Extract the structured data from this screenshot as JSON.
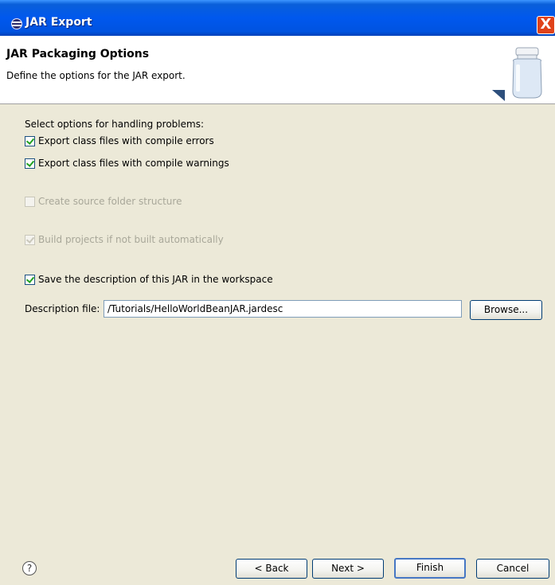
{
  "window": {
    "title": "JAR Export",
    "close_label": "X"
  },
  "header": {
    "title": "JAR Packaging Options",
    "description": "Define the options for the JAR export."
  },
  "problems": {
    "heading": "Select options for handling problems:",
    "export_errors": {
      "label": "Export class files with compile errors",
      "checked": true,
      "enabled": true
    },
    "export_warnings": {
      "label": "Export class files with compile warnings",
      "checked": true,
      "enabled": true
    }
  },
  "source_folder": {
    "label": "Create source folder structure",
    "checked": false,
    "enabled": false
  },
  "build_projects": {
    "label": "Build projects if not built automatically",
    "checked": true,
    "enabled": false
  },
  "save_description": {
    "label": "Save the description of this JAR in the workspace",
    "checked": true,
    "enabled": true
  },
  "description_file": {
    "label": "Description file:",
    "value": "/Tutorials/HelloWorldBeanJAR.jardesc",
    "browse_label": "Browse..."
  },
  "footer": {
    "help_label": "?",
    "back_label": "< Back",
    "next_label": "Next >",
    "finish_label": "Finish",
    "cancel_label": "Cancel"
  },
  "colors": {
    "titlebar": "#0058ee",
    "dialog_bg": "#ece9d8",
    "header_bg": "#ffffff",
    "check_mark": "#21a121"
  },
  "icons": {
    "title_icon": "eclipse-icon",
    "banner_icon": "jar-icon",
    "help_icon": "help-icon"
  }
}
